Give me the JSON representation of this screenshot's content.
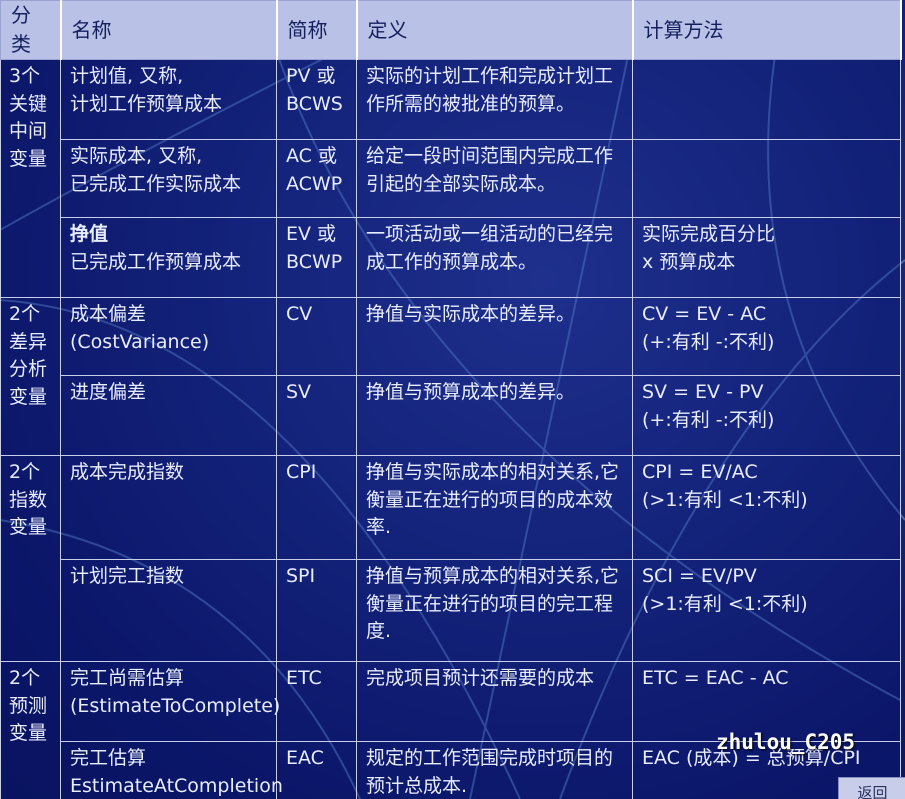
{
  "table": {
    "headers": [
      "分类",
      "名称",
      "简称",
      "定义",
      "计算方法"
    ],
    "groups": [
      {
        "category": [
          "3个",
          "关键",
          "中间",
          "变量"
        ]
      },
      {
        "category": [
          "2个",
          "差异",
          "分析",
          "变量"
        ]
      },
      {
        "category": [
          "2个",
          "指数",
          "变量"
        ]
      },
      {
        "category": [
          "2个",
          "预测",
          "变量"
        ]
      }
    ],
    "rows": [
      {
        "name": [
          "计划值, 又称,",
          "计划工作预算成本"
        ],
        "abbr": [
          "PV 或",
          "BCWS"
        ],
        "definition": [
          "实际的计划工作和完成计划工",
          "作所需的被批准的预算。"
        ],
        "method": []
      },
      {
        "name": [
          "实际成本, 又称,",
          "已完成工作实际成本"
        ],
        "abbr": [
          "AC 或",
          "ACWP"
        ],
        "definition": [
          "给定一段时间范围内完成工作",
          "引起的全部实际成本。"
        ],
        "method": []
      },
      {
        "name": [
          "挣值",
          "已完成工作预算成本"
        ],
        "abbr": [
          "EV 或",
          "BCWP"
        ],
        "definition": [
          "一项活动或一组活动的已经完",
          "成工作的预算成本。"
        ],
        "method": [
          "实际完成百分比",
          "x  预算成本"
        ]
      },
      {
        "name": [
          "成本偏差",
          "(CostVariance)"
        ],
        "abbr": [
          "CV"
        ],
        "definition": [
          "挣值与实际成本的差异。"
        ],
        "method": [
          "CV  = EV  - AC",
          "(+:有利  -:不利)"
        ]
      },
      {
        "name": [
          "进度偏差"
        ],
        "abbr": [
          "SV"
        ],
        "definition": [
          "挣值与预算成本的差异。"
        ],
        "method": [
          "SV  = EV  - PV",
          "(+:有利  -:不利)"
        ]
      },
      {
        "name": [
          "成本完成指数"
        ],
        "abbr": [
          "CPI"
        ],
        "definition": [
          "挣值与实际成本的相对关系,它",
          "衡量正在进行的项目的成本效",
          "率."
        ],
        "method": [
          "CPI = EV/AC",
          "(>1:有利     <1:不利)"
        ]
      },
      {
        "name": [
          "计划完工指数"
        ],
        "abbr": [
          "SPI"
        ],
        "definition": [
          "挣值与预算成本的相对关系,它",
          "衡量正在进行的项目的完工程",
          "度."
        ],
        "method": [
          "SCI = EV/PV",
          "(>1:有利     <1:不利)"
        ]
      },
      {
        "name": [
          "完工尚需估算",
          "(EstimateToComplete)"
        ],
        "abbr": [
          "ETC"
        ],
        "definition": [
          "完成项目预计还需要的成本"
        ],
        "method": [
          "ETC = EAC - AC"
        ]
      },
      {
        "name": [
          "完工估算",
          "EstimateAtCompletion"
        ],
        "abbr": [
          "EAC"
        ],
        "definition": [
          "规定的工作范围完成时项目的",
          "预计总成本."
        ],
        "method": [
          "EAC (成本) = 总预算/CPI"
        ]
      }
    ]
  },
  "watermark": "zhulou_C205",
  "back_button": "返回"
}
